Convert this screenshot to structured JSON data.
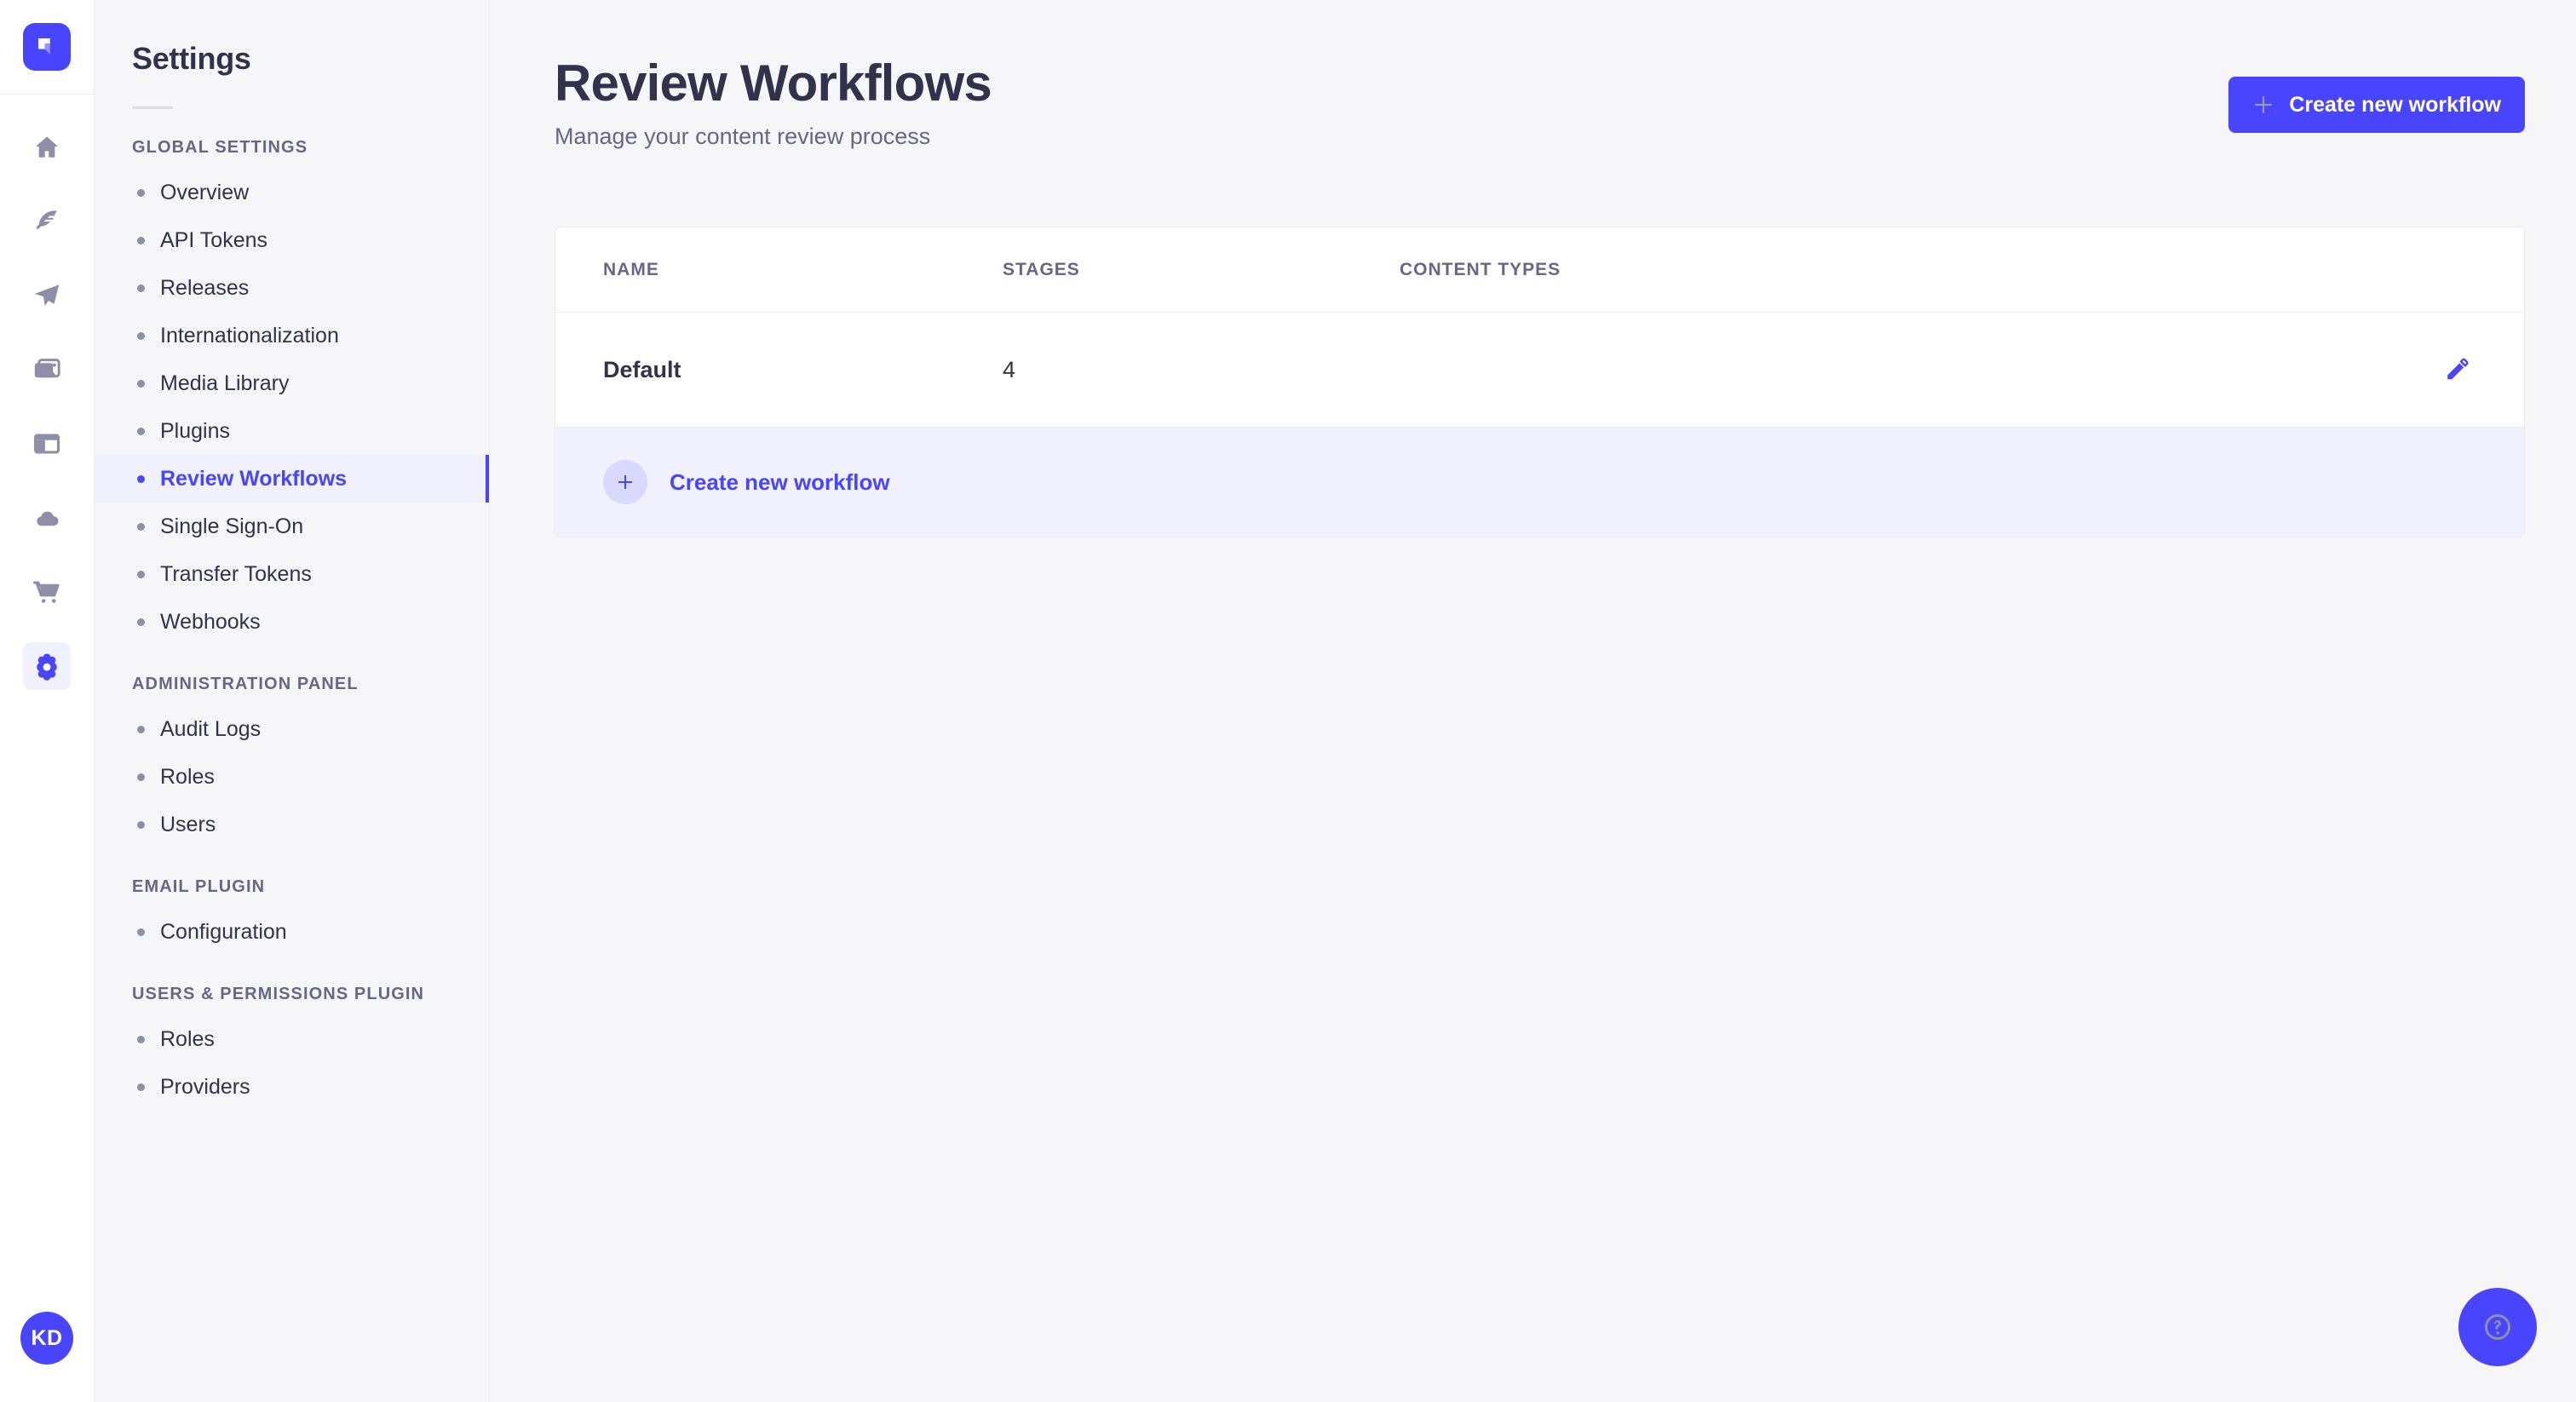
{
  "brand": {
    "logo_icon": "strapi-logo-icon",
    "accent": "#4945ff",
    "accent_soft": "#f0f0ff",
    "badge_soft": "#d9d8ff",
    "text_dark": "#32324d",
    "text_muted": "#666687",
    "page_bg": "#f6f6f9",
    "border": "#eaeaef"
  },
  "rail": {
    "items": [
      {
        "icon": "home-icon",
        "name": "rail-item-home",
        "active": false
      },
      {
        "icon": "feather-icon",
        "name": "rail-item-content-manager",
        "active": false
      },
      {
        "icon": "paper-plane-icon",
        "name": "rail-item-content-type-builder",
        "active": false
      },
      {
        "icon": "images-icon",
        "name": "rail-item-media-library",
        "active": false
      },
      {
        "icon": "layout-icon",
        "name": "rail-item-pages",
        "active": false
      },
      {
        "icon": "cloud-icon",
        "name": "rail-item-cloud",
        "active": false
      },
      {
        "icon": "shopping-cart-icon",
        "name": "rail-item-marketplace",
        "active": false
      },
      {
        "icon": "gear-icon",
        "name": "rail-item-settings",
        "active": true
      }
    ],
    "avatar_initials": "KD"
  },
  "subnav": {
    "title": "Settings",
    "sections": [
      {
        "title": "GLOBAL SETTINGS",
        "items": [
          {
            "label": "Overview",
            "active": false
          },
          {
            "label": "API Tokens",
            "active": false
          },
          {
            "label": "Releases",
            "active": false
          },
          {
            "label": "Internationalization",
            "active": false
          },
          {
            "label": "Media Library",
            "active": false
          },
          {
            "label": "Plugins",
            "active": false
          },
          {
            "label": "Review Workflows",
            "active": true
          },
          {
            "label": "Single Sign-On",
            "active": false
          },
          {
            "label": "Transfer Tokens",
            "active": false
          },
          {
            "label": "Webhooks",
            "active": false
          }
        ]
      },
      {
        "title": "ADMINISTRATION PANEL",
        "items": [
          {
            "label": "Audit Logs",
            "active": false
          },
          {
            "label": "Roles",
            "active": false
          },
          {
            "label": "Users",
            "active": false
          }
        ]
      },
      {
        "title": "EMAIL PLUGIN",
        "items": [
          {
            "label": "Configuration",
            "active": false
          }
        ]
      },
      {
        "title": "USERS & PERMISSIONS PLUGIN",
        "items": [
          {
            "label": "Roles",
            "active": false
          },
          {
            "label": "Providers",
            "active": false
          }
        ]
      }
    ]
  },
  "main": {
    "title": "Review Workflows",
    "subtitle": "Manage your content review process",
    "create_button_label": "Create new workflow",
    "table": {
      "columns": [
        "NAME",
        "STAGES",
        "CONTENT TYPES",
        ""
      ],
      "rows": [
        {
          "name": "Default",
          "stages": "4",
          "content_types": "",
          "action_icon": "pencil-icon"
        }
      ]
    },
    "footer_action_label": "Create new workflow"
  },
  "help": {
    "icon": "question-mark-circle-icon"
  }
}
